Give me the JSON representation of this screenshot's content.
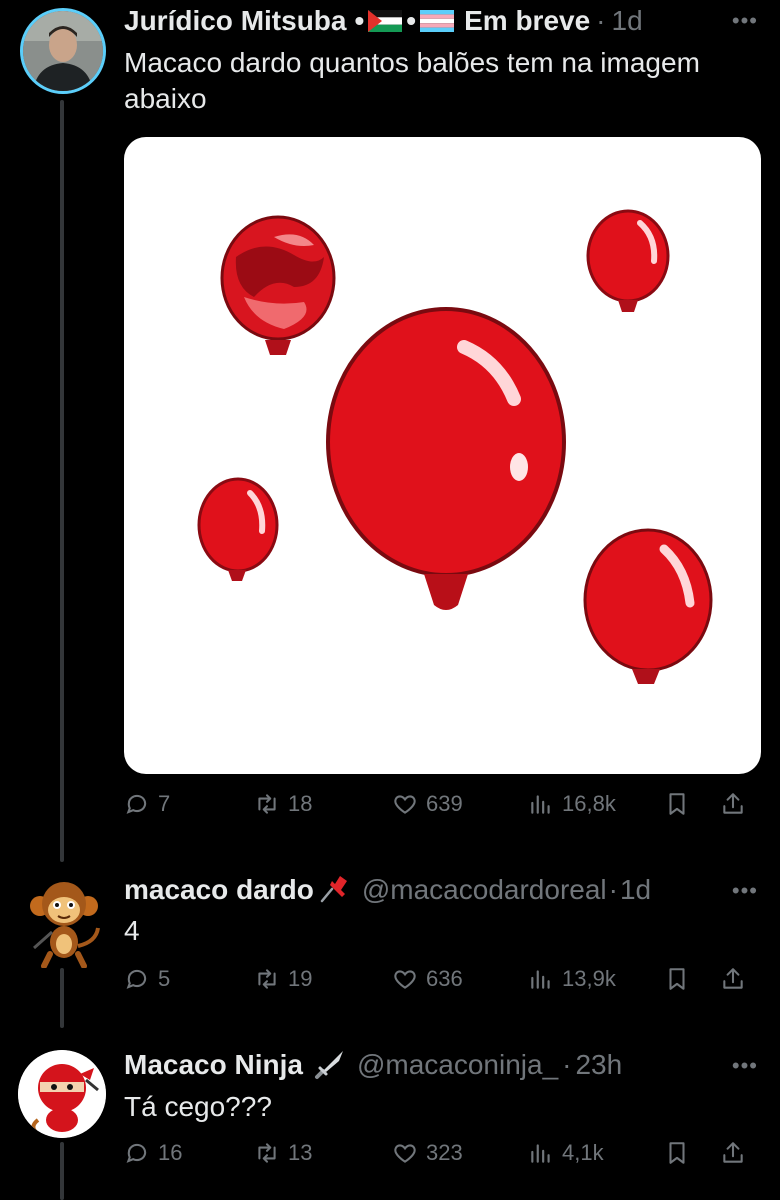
{
  "tweets": [
    {
      "display_name": "Jurídico Mitsuba",
      "name_suffix": "Em breve",
      "handle": "",
      "time": "1d",
      "text": "Macaco dardo quantos balões tem na imagem abaixo",
      "replies": "7",
      "retweets": "18",
      "likes": "639",
      "views": "16,8k"
    },
    {
      "display_name": "macaco dardo",
      "handle": "@macacodardoreal",
      "time": "1d",
      "text": "4",
      "replies": "5",
      "retweets": "19",
      "likes": "636",
      "views": "13,9k"
    },
    {
      "display_name": "Macaco Ninja",
      "handle": "@macaconinja_",
      "time": "23h",
      "text": "Tá cego???",
      "replies": "16",
      "retweets": "13",
      "likes": "323",
      "views": "4,1k"
    }
  ],
  "icons": {
    "more": "more-icon",
    "reply": "reply-icon",
    "retweet": "retweet-icon",
    "like": "heart-icon",
    "views": "views-icon",
    "bookmark": "bookmark-icon",
    "share": "share-icon"
  },
  "colors": {
    "background": "#000000",
    "text": "#e7e9ea",
    "muted": "#71767b",
    "balloon": "#e0111b"
  }
}
